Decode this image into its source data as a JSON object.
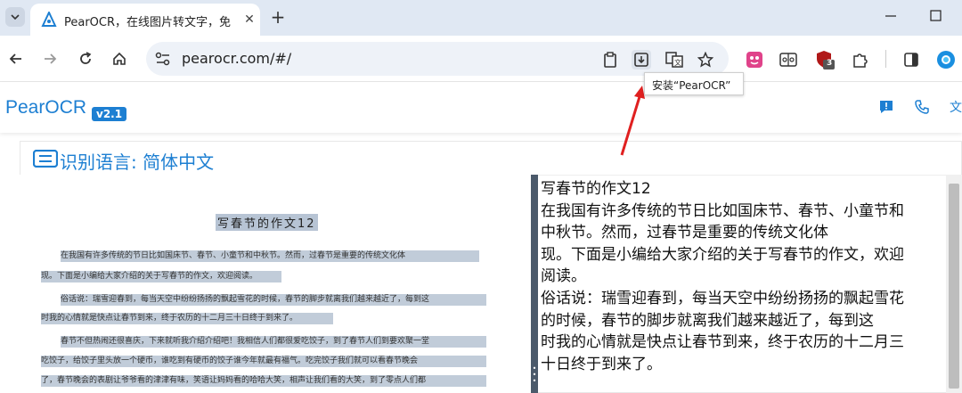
{
  "browser": {
    "tab_title": "PearOCR，在线图片转文字，免",
    "url": "pearocr.com/#/",
    "extension_badge": "3",
    "tooltip": "安装“PearOCR”"
  },
  "app": {
    "brand": "PearOCR",
    "version": "v2.1",
    "language_label": "识别语言: 简体中文"
  },
  "scan": {
    "title": "写春节的作文12",
    "lines": [
      "在我国有许多传统的节日比如国床节、春节、小童节和中秋节。然而，过春节是重要的传统文化体",
      "现。下面是小编给大家介绍的关于写春节的作文，欢迎阅读。",
      "俗话说：瑞雪迎春到，每当天空中纷纷扬扬的飘起雪花的时候，春节的脚步就离我们越来越近了，每到这",
      "时我的心情就是快点让春节到来，终于农历的十二月三十日终于到来了。",
      "春节不但热闹还很喜庆，下来就听我介绍介绍吧！我相信人们都很爱吃饺子，到了春节人们到要欢聚一堂",
      "吃饺子，给饺子里头放一个硬币，谁吃到有硬币的饺子谁今年就最有福气。吃完饺子我们就可以看春节晚会",
      "了，春节晚会的表剧让爷爷看的津津有味，笑语让妈妈看的哈哈大笑，相声让我们看的大笑，到了零点人们都"
    ]
  },
  "result": {
    "lines": [
      "写春节的作文12",
      "在我国有许多传统的节日比如国床节、春节、小童节和",
      "中秋节。然而，过春节是重要的传统文化体",
      "现。下面是小编给大家介绍的关于写春节的作文，欢迎",
      "阅读。",
      "俗话说：瑞雪迎春到，每当天空中纷纷扬扬的飘起雪花",
      "的时候，春节的脚步就离我们越来越近了，每到这",
      "时我的心情就是快点让春节到来，终于农历的十二月三",
      "十日终于到来了。"
    ]
  },
  "colors": {
    "accent": "#1d7fd2",
    "tab_strip": "#e0e8f3",
    "arrow": "#e02020"
  }
}
